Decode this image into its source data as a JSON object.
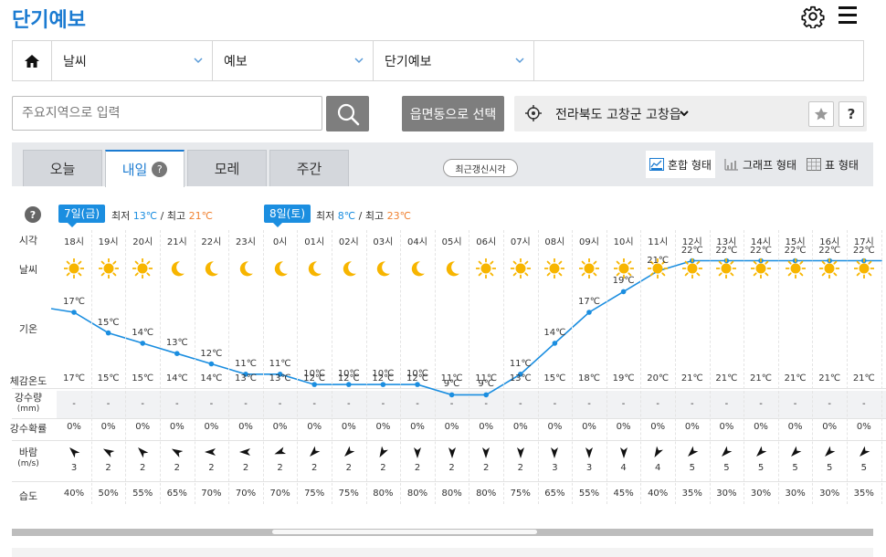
{
  "header": {
    "title": "단기예보"
  },
  "nav": {
    "items": [
      "날씨",
      "예보",
      "단기예보"
    ]
  },
  "search": {
    "placeholder": "주요지역으로 입력",
    "emd_button": "읍면동으로 선택",
    "location": "전라북도 고창군 고창읍"
  },
  "tabs": [
    "오늘",
    "내일",
    "모레",
    "주간"
  ],
  "active_tab": 1,
  "update_button": "최근갱신시각",
  "views": [
    "혼합 형태",
    "그래프 형태",
    "표 형태"
  ],
  "days": [
    {
      "label": "7일(금)",
      "min_label": "최저",
      "min": "13℃",
      "max_label": "최고",
      "max": "21℃",
      "sep": "/"
    },
    {
      "label": "8일(토)",
      "min_label": "최저",
      "min": "8℃",
      "max_label": "최고",
      "max": "23℃",
      "sep": "/"
    }
  ],
  "row_labels": {
    "time": "시각",
    "weather": "날씨",
    "temp": "기온",
    "feels": "체감온도",
    "rain": "강수량",
    "rain_unit": "(mm)",
    "prob": "강수확률",
    "wind": "바람",
    "wind_unit": "(m/s)",
    "humidity": "습도"
  },
  "colors": {
    "accent": "#1b7bd1",
    "badge": "#1b8ee0",
    "sun": "#f7b500",
    "max_temp": "#f08232"
  },
  "hourly": [
    {
      "time": "18시",
      "weather": "sun",
      "temp": 17,
      "feels": "17℃",
      "rain": "-",
      "prob": "0%",
      "wind_dir": 315,
      "wind": "3",
      "hum": "40%"
    },
    {
      "time": "19시",
      "weather": "sun",
      "temp": 15,
      "feels": "15℃",
      "rain": "-",
      "prob": "0%",
      "wind_dir": 300,
      "wind": "2",
      "hum": "50%"
    },
    {
      "time": "20시",
      "weather": "sun",
      "temp": 14,
      "feels": "15℃",
      "rain": "-",
      "prob": "0%",
      "wind_dir": 315,
      "wind": "2",
      "hum": "55%"
    },
    {
      "time": "21시",
      "weather": "moon",
      "temp": 13,
      "feels": "14℃",
      "rain": "-",
      "prob": "0%",
      "wind_dir": 300,
      "wind": "2",
      "hum": "65%"
    },
    {
      "time": "22시",
      "weather": "moon",
      "temp": 12,
      "feels": "14℃",
      "rain": "-",
      "prob": "0%",
      "wind_dir": 270,
      "wind": "2",
      "hum": "70%"
    },
    {
      "time": "23시",
      "weather": "moon",
      "temp": 11,
      "feels": "13℃",
      "rain": "-",
      "prob": "0%",
      "wind_dir": 270,
      "wind": "2",
      "hum": "70%"
    },
    {
      "time": "0시",
      "weather": "moon",
      "temp": 11,
      "feels": "13℃",
      "rain": "-",
      "prob": "0%",
      "wind_dir": 250,
      "wind": "2",
      "hum": "70%"
    },
    {
      "time": "01시",
      "weather": "moon",
      "temp": 10,
      "feels": "12℃",
      "rain": "-",
      "prob": "0%",
      "wind_dir": 225,
      "wind": "2",
      "hum": "75%"
    },
    {
      "time": "02시",
      "weather": "moon",
      "temp": 10,
      "feels": "12℃",
      "rain": "-",
      "prob": "0%",
      "wind_dir": 225,
      "wind": "2",
      "hum": "75%"
    },
    {
      "time": "03시",
      "weather": "moon",
      "temp": 10,
      "feels": "12℃",
      "rain": "-",
      "prob": "0%",
      "wind_dir": 210,
      "wind": "2",
      "hum": "80%"
    },
    {
      "time": "04시",
      "weather": "moon",
      "temp": 10,
      "feels": "12℃",
      "rain": "-",
      "prob": "0%",
      "wind_dir": 180,
      "wind": "2",
      "hum": "80%"
    },
    {
      "time": "05시",
      "weather": "moon",
      "temp": 9,
      "feels": "11℃",
      "rain": "-",
      "prob": "0%",
      "wind_dir": 180,
      "wind": "2",
      "hum": "80%"
    },
    {
      "time": "06시",
      "weather": "sun",
      "temp": 9,
      "feels": "11℃",
      "rain": "-",
      "prob": "0%",
      "wind_dir": 180,
      "wind": "2",
      "hum": "80%"
    },
    {
      "time": "07시",
      "weather": "sun",
      "temp": 11,
      "feels": "13℃",
      "rain": "-",
      "prob": "0%",
      "wind_dir": 180,
      "wind": "2",
      "hum": "75%"
    },
    {
      "time": "08시",
      "weather": "sun",
      "temp": 14,
      "feels": "15℃",
      "rain": "-",
      "prob": "0%",
      "wind_dir": 180,
      "wind": "3",
      "hum": "65%"
    },
    {
      "time": "09시",
      "weather": "sun",
      "temp": 17,
      "feels": "18℃",
      "rain": "-",
      "prob": "0%",
      "wind_dir": 180,
      "wind": "3",
      "hum": "55%"
    },
    {
      "time": "10시",
      "weather": "sun",
      "temp": 19,
      "feels": "19℃",
      "rain": "-",
      "prob": "0%",
      "wind_dir": 180,
      "wind": "4",
      "hum": "45%"
    },
    {
      "time": "11시",
      "weather": "sun",
      "temp": 21,
      "feels": "20℃",
      "rain": "-",
      "prob": "0%",
      "wind_dir": 210,
      "wind": "4",
      "hum": "40%"
    },
    {
      "time": "12시",
      "weather": "sun",
      "temp": 22,
      "feels": "21℃",
      "rain": "-",
      "prob": "0%",
      "wind_dir": 225,
      "wind": "5",
      "hum": "35%"
    },
    {
      "time": "13시",
      "weather": "sun",
      "temp": 22,
      "feels": "21℃",
      "rain": "-",
      "prob": "0%",
      "wind_dir": 225,
      "wind": "5",
      "hum": "30%"
    },
    {
      "time": "14시",
      "weather": "sun",
      "temp": 22,
      "feels": "21℃",
      "rain": "-",
      "prob": "0%",
      "wind_dir": 225,
      "wind": "5",
      "hum": "30%"
    },
    {
      "time": "15시",
      "weather": "sun",
      "temp": 22,
      "feels": "21℃",
      "rain": "-",
      "prob": "0%",
      "wind_dir": 225,
      "wind": "5",
      "hum": "30%"
    },
    {
      "time": "16시",
      "weather": "sun",
      "temp": 22,
      "feels": "21℃",
      "rain": "-",
      "prob": "0%",
      "wind_dir": 225,
      "wind": "5",
      "hum": "30%"
    },
    {
      "time": "17시",
      "weather": "sun",
      "temp": 22,
      "feels": "21℃",
      "rain": "-",
      "prob": "0%",
      "wind_dir": 225,
      "wind": "5",
      "hum": "35%"
    }
  ]
}
